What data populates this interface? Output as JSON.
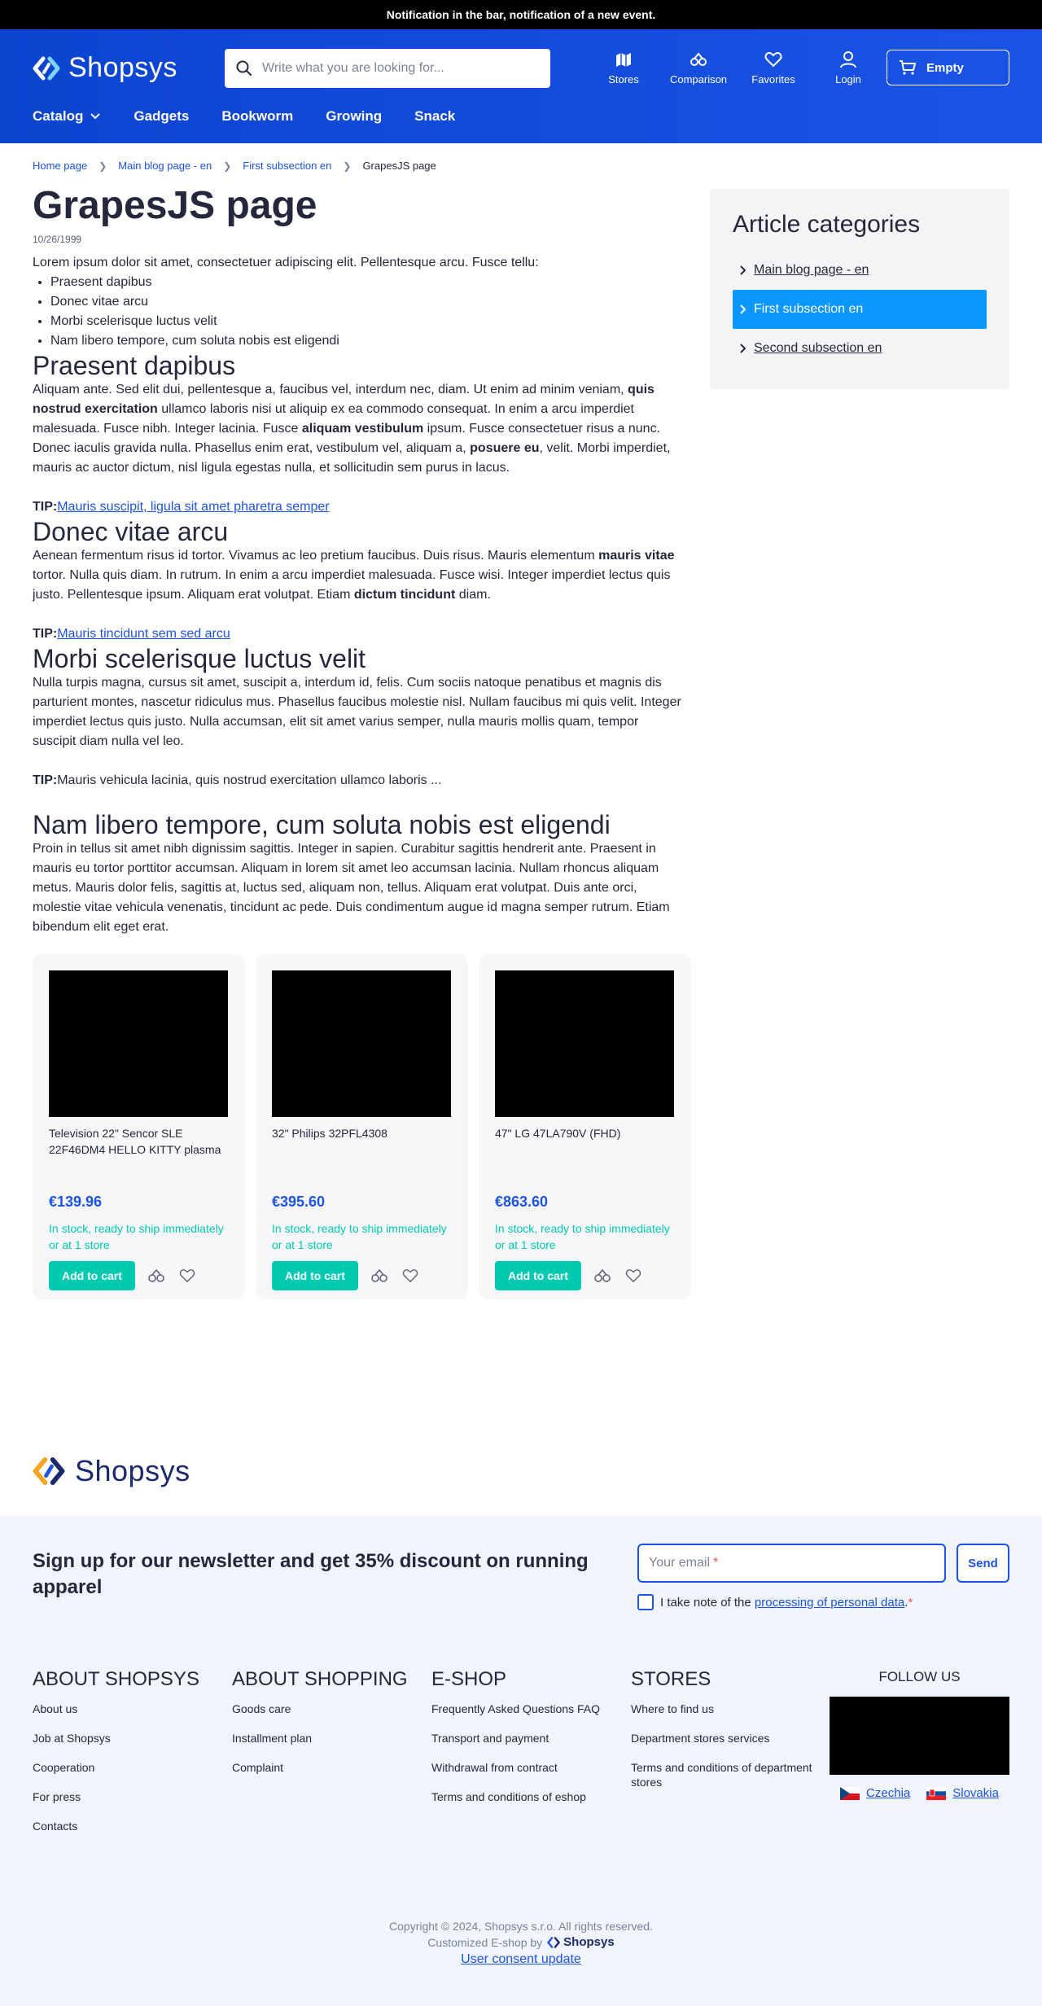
{
  "notification": "Notification in the bar, notification of a new event.",
  "brand": {
    "name": "Shopsys",
    "color": "#1b53e6"
  },
  "search": {
    "placeholder": "Write what you are looking for..."
  },
  "header_links": [
    {
      "label": "Stores",
      "icon": "map-icon"
    },
    {
      "label": "Comparison",
      "icon": "compare-icon"
    },
    {
      "label": "Favorites",
      "icon": "heart-icon"
    },
    {
      "label": "Login",
      "icon": "user-icon"
    }
  ],
  "cart": {
    "label": "Empty"
  },
  "nav": [
    "Catalog",
    "Gadgets",
    "Bookworm",
    "Growing",
    "Snack"
  ],
  "breadcrumb": [
    "Home page",
    "Main blog page - en",
    "First subsection en",
    "GrapesJS page"
  ],
  "article": {
    "title": "GrapesJS page",
    "date": "10/26/1999",
    "intro": "Lorem ipsum dolor sit amet, consectetuer adipiscing elit. Pellentesque arcu. Fusce tellu:",
    "list": [
      "Praesent dapibus",
      "Donec vitae arcu",
      "Morbi scelerisque luctus velit",
      "Nam libero tempore, cum soluta nobis est eligendi"
    ],
    "sections": [
      {
        "heading": "Praesent dapibus",
        "p1": "Aliquam ante. Sed elit dui, pellentesque a, faucibus vel, interdum nec, diam. Ut enim ad minim veniam,",
        "b1": "quis nostrud exercitation",
        "p2": " ullamco laboris nisi ut aliquip ex ea commodo consequat. In enim a arcu imperdiet malesuada. Fusce nibh. Integer lacinia. Fusce ",
        "b2": "aliquam vestibulum",
        "p3": " ipsum. Fusce consectetuer risus a nunc. Donec iaculis gravida nulla. Phasellus enim erat, vestibulum vel, aliquam a, ",
        "b3": "posuere eu",
        "p4": ", velit. Morbi imperdiet, mauris ac auctor dictum, nisl ligula egestas nulla, et sollicitudin sem purus in lacus.",
        "tip_label": "TIP:",
        "tip_text": "Mauris suscipit, ligula sit amet pharetra semper"
      },
      {
        "heading": "Donec vitae arcu",
        "p1": "Aenean fermentum risus id tortor. Vivamus ac leo pretium faucibus. Duis risus. Mauris elementum ",
        "b1": "mauris vitae",
        "p2": " tortor. Nulla quis diam. In rutrum. In enim a arcu imperdiet malesuada. Fusce wisi. Integer imperdiet lectus quis justo. Pellentesque ipsum. Aliquam erat volutpat. Etiam ",
        "b2": "dictum tincidunt",
        "p3": " diam.",
        "tip_label": "TIP:",
        "tip_text": "Mauris tincidunt sem sed arcu"
      },
      {
        "heading": "Morbi scelerisque luctus velit",
        "p1": "Nulla turpis magna, cursus sit amet, suscipit a, interdum id, felis. Cum sociis natoque penatibus et magnis dis parturient montes, nascetur ridiculus mus. Phasellus faucibus molestie nisl. Nullam faucibus mi quis velit. Integer imperdiet lectus quis justo. Nulla accumsan, elit sit amet varius semper, nulla mauris mollis quam, tempor suscipit diam nulla vel leo.",
        "tip_label": "TIP:",
        "tip_text": "Mauris vehicula lacinia, quis nostrud exercitation ullamco laboris ..."
      },
      {
        "heading": "Nam libero tempore, cum soluta nobis est eligendi",
        "p1": "Proin in tellus sit amet nibh dignissim sagittis. Integer in sapien. Curabitur sagittis hendrerit ante. Praesent in mauris eu tortor porttitor accumsan. Aliquam in lorem sit amet leo accumsan lacinia. Nullam rhoncus aliquam metus. Mauris dolor felis, sagittis at, luctus sed, aliquam non, tellus. Aliquam erat volutpat. Duis ante orci, molestie vitae vehicula venenatis, tincidunt ac pede. Duis condimentum augue id magna semper rutrum. Etiam bibendum elit eget erat."
      }
    ]
  },
  "products": [
    {
      "name": "Television 22\" Sencor SLE 22F46DM4 HELLO KITTY plasma",
      "price": "€139.96",
      "stock": "In stock, ready to ship immediately or at 1 store",
      "cta": "Add to cart"
    },
    {
      "name": "32\" Philips 32PFL4308",
      "price": "€395.60",
      "stock": "In stock, ready to ship immediately or at 1 store",
      "cta": "Add to cart"
    },
    {
      "name": "47\" LG 47LA790V (FHD)",
      "price": "€863.60",
      "stock": "In stock, ready to ship immediately or at 1 store",
      "cta": "Add to cart"
    }
  ],
  "sidebar": {
    "title": "Article categories",
    "items": [
      {
        "label": "Main blog page - en",
        "active": false
      },
      {
        "label": "First subsection en",
        "active": true
      },
      {
        "label": "Second subsection en",
        "active": false
      }
    ]
  },
  "newsletter": {
    "title": "Sign up for our newsletter and get 35% discount on running apparel",
    "email_placeholder": "Your email",
    "required_mark": "*",
    "send": "Send",
    "consent_prefix": "I take note of the ",
    "consent_link": "processing of personal data",
    "consent_suffix": "."
  },
  "footer": {
    "columns": [
      {
        "title": "ABOUT SHOPSYS",
        "links": [
          "About us",
          "Job at Shopsys",
          "Cooperation",
          "For press",
          "Contacts"
        ]
      },
      {
        "title": "ABOUT SHOPPING",
        "links": [
          "Goods care",
          "Installment plan",
          "Complaint"
        ]
      },
      {
        "title": "E-SHOP",
        "links": [
          "Frequently Asked Questions FAQ",
          "Transport and payment",
          "Withdrawal from contract",
          "Terms and conditions of eshop"
        ]
      },
      {
        "title": "STORES",
        "links": [
          "Where to find us",
          "Department stores services",
          "Terms and conditions of department stores"
        ]
      }
    ],
    "follow_title": "FOLLOW US",
    "languages": [
      "Czechia",
      "Slovakia"
    ],
    "copyright": "Copyright © 2024, Shopsys s.r.o. All rights reserved.",
    "made_by": "Customized E-shop by",
    "made_by_brand": "Shopsys",
    "consent_update": "User consent update"
  },
  "colors": {
    "accent": "#1b53e6",
    "success": "#00c9b1",
    "active": "#0a97ff",
    "header": "#0b44cf"
  }
}
